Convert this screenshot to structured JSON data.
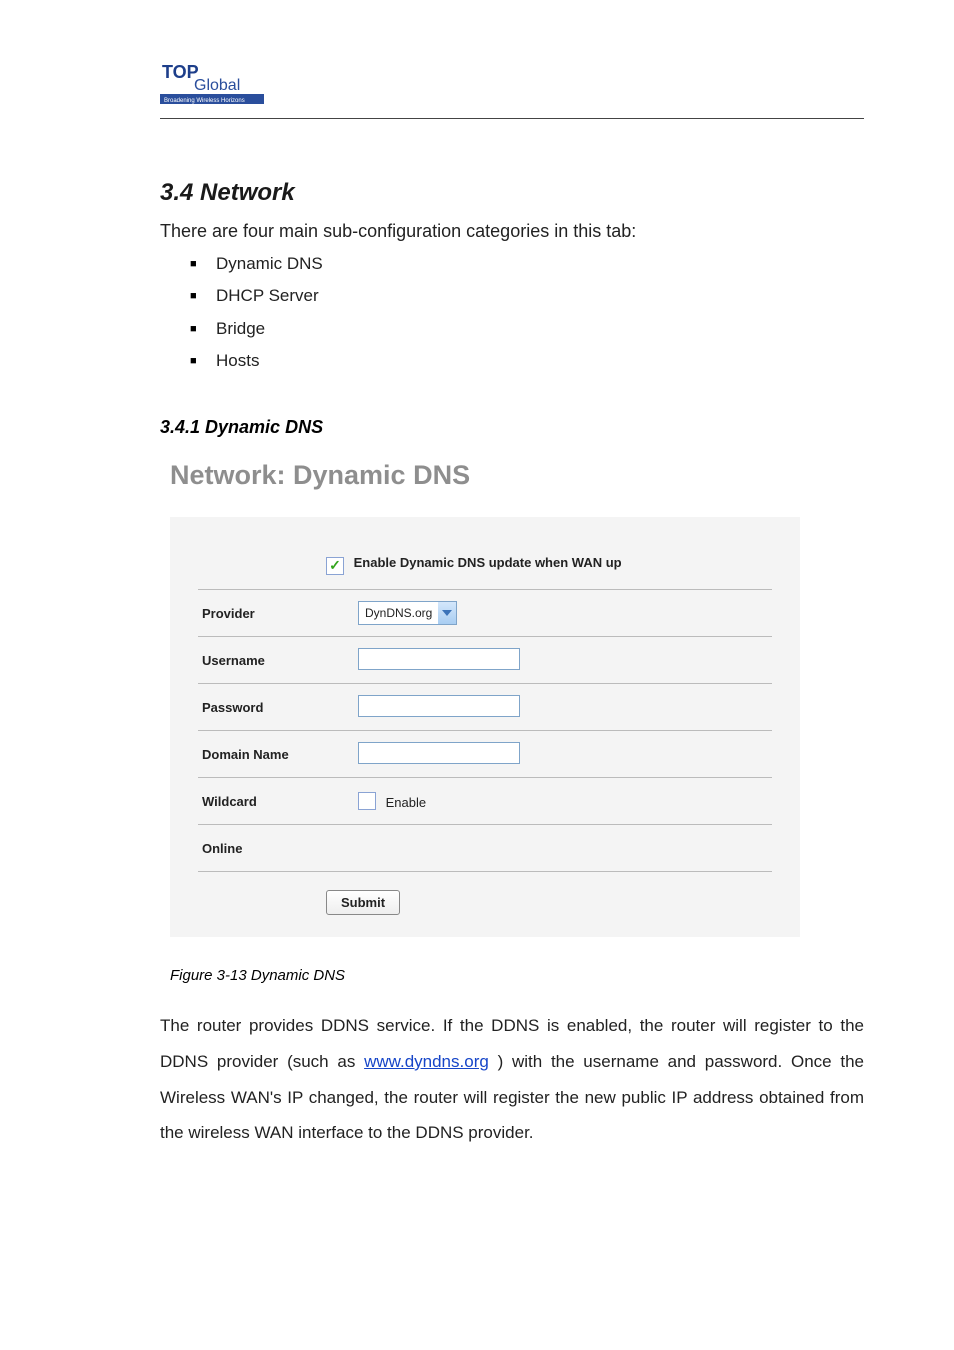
{
  "logo": {
    "top": "TOP",
    "bottom": "Global",
    "tag": "Broadening Wireless Horizons"
  },
  "section_num": "3.4 Network",
  "sub_intro": "There are four main sub-configuration categories in this tab:",
  "tabs": [
    "Dynamic DNS",
    "DHCP Server",
    "Bridge",
    "Hosts"
  ],
  "sub_heading": "3.4.1 Dynamic DNS",
  "panel_title": "Network: Dynamic DNS",
  "form": {
    "enable_label": "Enable Dynamic DNS update when WAN up",
    "rows": {
      "provider": {
        "label": "Provider",
        "value": "DynDNS.org"
      },
      "username": {
        "label": "Username"
      },
      "password": {
        "label": "Password"
      },
      "domain_name": {
        "label": "Domain Name"
      },
      "wildcard": {
        "label": "Wildcard",
        "option": "Enable"
      },
      "online": {
        "label": "Online"
      }
    },
    "submit": "Submit"
  },
  "figcap": "Figure 3-13 Dynamic DNS",
  "para": {
    "lead": "The router provides DDNS service. If the DDNS is enabled, the router will register to the DDNS provider (such as ",
    "link": "www.dyndns.org",
    "tail1": ") with the username and password. Once the Wireless WAN's IP changed, the router will register the new public IP address obtained from the wireless WAN interface to the DDNS provider."
  }
}
